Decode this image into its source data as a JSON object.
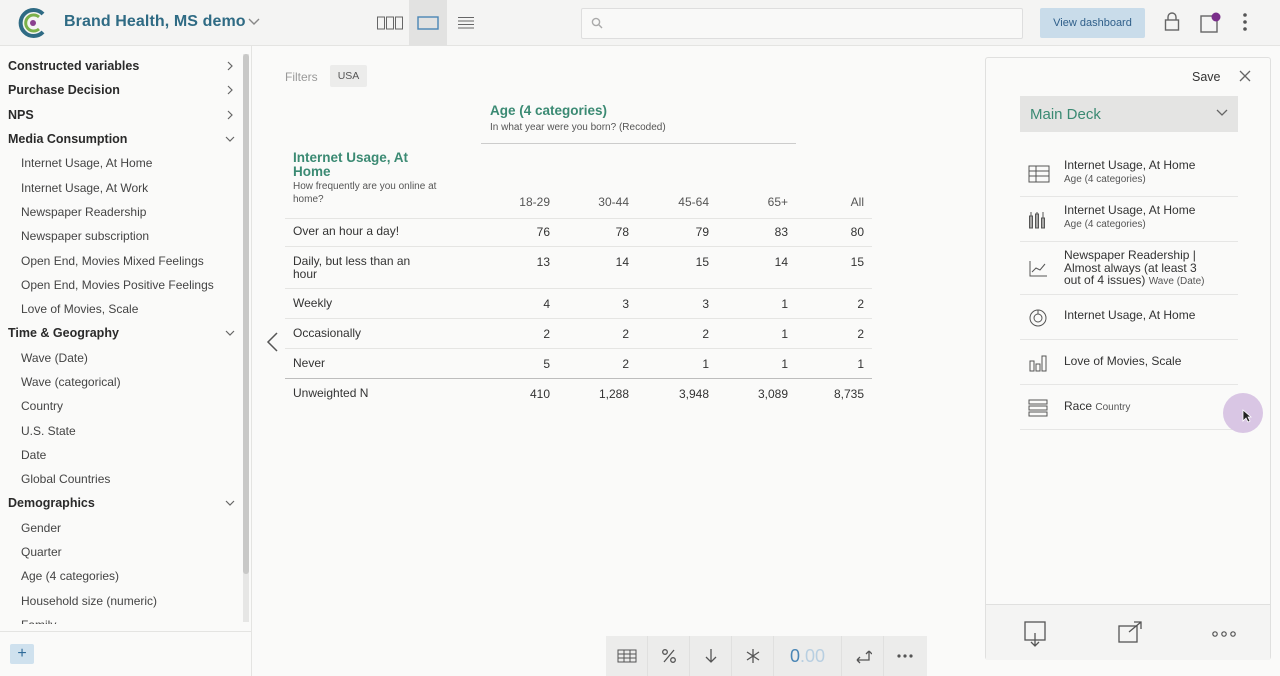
{
  "app": {
    "title": "Brand Health, MS demo",
    "search_placeholder": "",
    "view_dashboard_label": "View dashboard",
    "accent": "#3b8a73",
    "title_color": "#2f6b84"
  },
  "sidebar": {
    "items": [
      {
        "label": "Constructed variables",
        "type": "group",
        "expanded": false
      },
      {
        "label": "Purchase Decision",
        "type": "group",
        "expanded": false
      },
      {
        "label": "NPS",
        "type": "group",
        "expanded": false
      },
      {
        "label": "Media Consumption",
        "type": "group",
        "expanded": true
      },
      {
        "label": "Internet Usage, At Home",
        "type": "child"
      },
      {
        "label": "Internet Usage, At Work",
        "type": "child"
      },
      {
        "label": "Newspaper Readership",
        "type": "child"
      },
      {
        "label": "Newspaper subscription",
        "type": "child"
      },
      {
        "label": "Open End, Movies Mixed Feelings",
        "type": "child"
      },
      {
        "label": "Open End, Movies Positive Feelings",
        "type": "child"
      },
      {
        "label": "Love of Movies, Scale",
        "type": "child"
      },
      {
        "label": "Time & Geography",
        "type": "group",
        "expanded": true
      },
      {
        "label": "Wave (Date)",
        "type": "child"
      },
      {
        "label": "Wave (categorical)",
        "type": "child"
      },
      {
        "label": "Country",
        "type": "child"
      },
      {
        "label": "U.S. State",
        "type": "child"
      },
      {
        "label": "Date",
        "type": "child"
      },
      {
        "label": "Global Countries",
        "type": "child"
      },
      {
        "label": "Demographics",
        "type": "group",
        "expanded": true
      },
      {
        "label": "Gender",
        "type": "child"
      },
      {
        "label": "Quarter",
        "type": "child"
      },
      {
        "label": "Age (4 categories)",
        "type": "child"
      },
      {
        "label": "Household size (numeric)",
        "type": "child"
      },
      {
        "label": "Family",
        "type": "child"
      }
    ],
    "add_label": "+"
  },
  "main": {
    "filters_label": "Filters",
    "filter_chip": "USA",
    "column_var": {
      "title": "Age (4 categories)",
      "subtitle": "In what year were you born? (Recoded)"
    },
    "row_var": {
      "title": "Internet Usage, At Home",
      "subtitle": "How frequently are you online at home?"
    },
    "headers": [
      "18-29",
      "30-44",
      "45-64",
      "65+",
      "All"
    ],
    "rows": [
      {
        "label": "Over an hour a day!",
        "values": [
          "76",
          "78",
          "79",
          "83",
          "80"
        ]
      },
      {
        "label": "Daily, but less than an hour",
        "values": [
          "13",
          "14",
          "15",
          "14",
          "15"
        ]
      },
      {
        "label": "Weekly",
        "values": [
          "4",
          "3",
          "3",
          "1",
          "2"
        ]
      },
      {
        "label": "Occasionally",
        "values": [
          "2",
          "2",
          "2",
          "1",
          "2"
        ]
      },
      {
        "label": "Never",
        "values": [
          "5",
          "2",
          "1",
          "1",
          "1"
        ]
      }
    ],
    "total_row": {
      "label": "Unweighted N",
      "values": [
        "410",
        "1,288",
        "3,948",
        "3,089",
        "8,735"
      ]
    }
  },
  "bottom_toolbar": {
    "decimals_main": "0",
    "decimals_faint": ".00"
  },
  "deck_panel": {
    "save_label": "Save",
    "deck_name": "Main Deck",
    "items": [
      {
        "icon": "table-icon",
        "title": "Internet Usage, At Home",
        "sub": "Age (4 categories)"
      },
      {
        "icon": "bar-chart-icon",
        "title": "Internet Usage, At Home",
        "sub": "Age (4 categories)"
      },
      {
        "icon": "line-chart-icon",
        "title": "Newspaper Readership | Almost always (at least 3 out of 4 issues)",
        "sub": "Wave (Date)"
      },
      {
        "icon": "donut-chart-icon",
        "title": "Internet Usage, At Home",
        "sub": ""
      },
      {
        "icon": "column-chart-icon",
        "title": "Love of Movies, Scale",
        "sub": ""
      },
      {
        "icon": "list-table-icon",
        "title": "Race",
        "sub": "Country"
      }
    ]
  }
}
